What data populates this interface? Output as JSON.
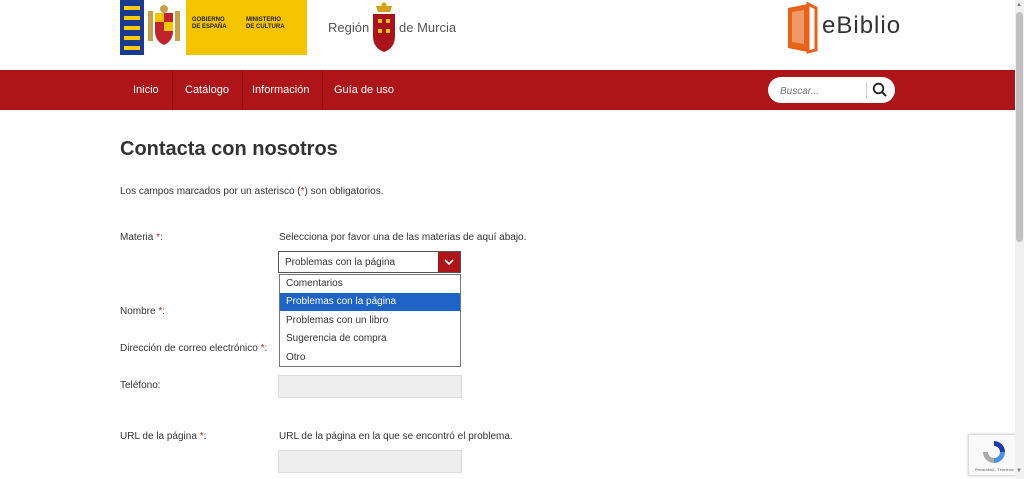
{
  "header": {
    "gobierno_line1": "GOBIERNO",
    "gobierno_line2": "DE ESPAÑA",
    "ministerio_line1": "MINISTERIO",
    "ministerio_line2": "DE CULTURA",
    "region_part1": "Región",
    "region_part2": "de Murcia",
    "ebiblio_logo": "eBiblio"
  },
  "nav": {
    "items": [
      "Inicio",
      "Catálogo",
      "Información",
      "Guía de uso"
    ],
    "search_placeholder": "Buscar...",
    "search_icon": "search-icon"
  },
  "main": {
    "title": "Contacta con nosotros",
    "required_note_before": "Los campos marcados por un asterisco (",
    "required_star": "*",
    "required_note_after": ") son obligatorios.",
    "fields": {
      "materia_label": "Materia",
      "materia_help": "Selecciona por favor una de las materias de aquí abajo.",
      "materia_selected": "Problemas con la página",
      "materia_options": [
        "Comentarios",
        "Problemas con la página",
        "Problemas con un libro",
        "Sugerencia de compra",
        "Otro"
      ],
      "nombre_label": "Nombre",
      "email_label": "Dirección de correo electrónico",
      "telefono_label": "Teléfono:",
      "url_label": "URL de la página",
      "url_help": "URL de la página en la que se encontró el problema."
    },
    "asterisk": "*",
    "colon": ":"
  },
  "recaptcha": {
    "terms": "Privacidad - Términos"
  },
  "colors": {
    "brand_red": "#ad1519",
    "selected_option": "#1e63c8",
    "asterisk": "#c0232b"
  }
}
